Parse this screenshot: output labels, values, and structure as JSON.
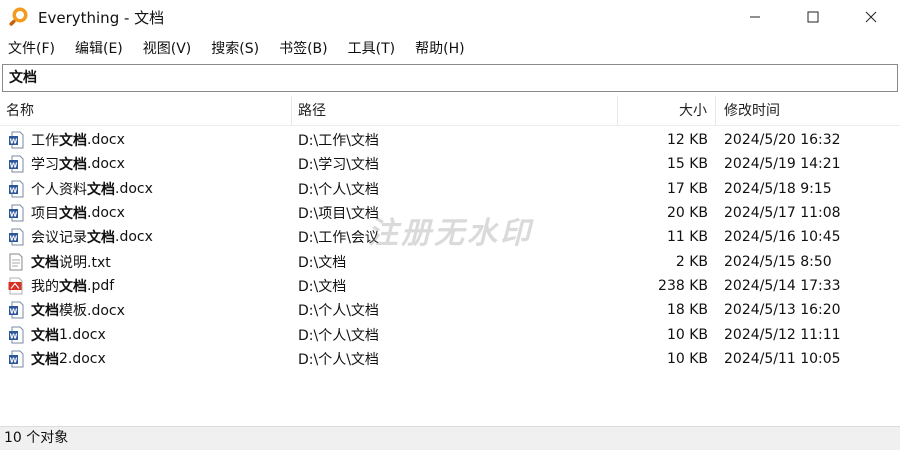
{
  "window": {
    "title": "Everything - 文档",
    "icon": "magnifier-icon"
  },
  "menu": [
    {
      "label": "文件(F)"
    },
    {
      "label": "编辑(E)"
    },
    {
      "label": "视图(V)"
    },
    {
      "label": "搜索(S)"
    },
    {
      "label": "书签(B)"
    },
    {
      "label": "工具(T)"
    },
    {
      "label": "帮助(H)"
    }
  ],
  "search": {
    "value": "文档"
  },
  "columns": {
    "name": "名称",
    "path": "路径",
    "size": "大小",
    "modified": "修改时间"
  },
  "files": [
    {
      "pre": "工作",
      "hl": "文档",
      "post": ".docx",
      "path": "D:\\工作\\文档",
      "size": "12 KB",
      "modified": "2024/5/20 16:32",
      "type": "docx"
    },
    {
      "pre": "学习",
      "hl": "文档",
      "post": ".docx",
      "path": "D:\\学习\\文档",
      "size": "15 KB",
      "modified": "2024/5/19 14:21",
      "type": "docx"
    },
    {
      "pre": "个人资料",
      "hl": "文档",
      "post": ".docx",
      "path": "D:\\个人\\文档",
      "size": "17 KB",
      "modified": "2024/5/18 9:15",
      "type": "docx"
    },
    {
      "pre": "项目",
      "hl": "文档",
      "post": ".docx",
      "path": "D:\\项目\\文档",
      "size": "20 KB",
      "modified": "2024/5/17 11:08",
      "type": "docx"
    },
    {
      "pre": "会议记录",
      "hl": "文档",
      "post": ".docx",
      "path": "D:\\工作\\会议",
      "size": "11 KB",
      "modified": "2024/5/16 10:45",
      "type": "docx"
    },
    {
      "pre": "",
      "hl": "文档",
      "post": "说明.txt",
      "path": "D:\\文档",
      "size": "2 KB",
      "modified": "2024/5/15 8:50",
      "type": "txt"
    },
    {
      "pre": "我的",
      "hl": "文档",
      "post": ".pdf",
      "path": "D:\\文档",
      "size": "238 KB",
      "modified": "2024/5/14 17:33",
      "type": "pdf"
    },
    {
      "pre": "",
      "hl": "文档",
      "post": "模板.docx",
      "path": "D:\\个人\\文档",
      "size": "18 KB",
      "modified": "2024/5/13 16:20",
      "type": "docx"
    },
    {
      "pre": "",
      "hl": "文档",
      "post": "1.docx",
      "path": "D:\\个人\\文档",
      "size": "10 KB",
      "modified": "2024/5/12 11:11",
      "type": "docx"
    },
    {
      "pre": "",
      "hl": "文档",
      "post": "2.docx",
      "path": "D:\\个人\\文档",
      "size": "10 KB",
      "modified": "2024/5/11 10:05",
      "type": "docx"
    }
  ],
  "watermark": "注册无水印",
  "status": "10 个对象",
  "colors": {
    "word_blue": "#2b579a",
    "pdf_red": "#d93025",
    "status_bg": "#f0f0f0"
  }
}
